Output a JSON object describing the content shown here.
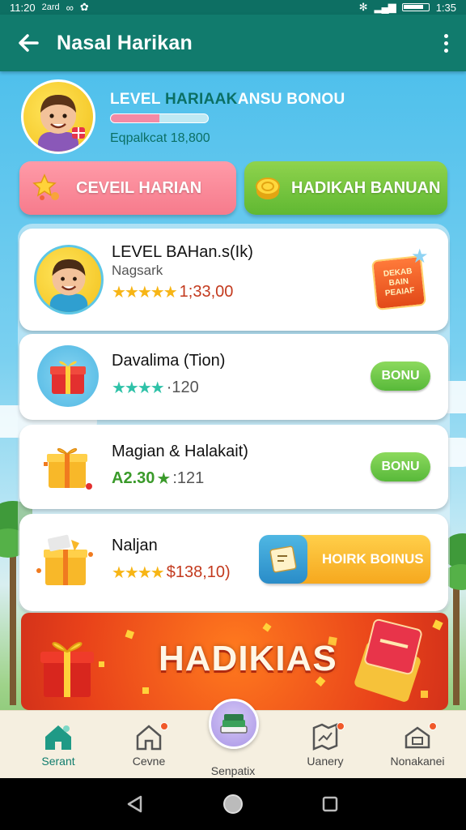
{
  "status_bar": {
    "time": "11:20",
    "carrier": "2ard",
    "clock_right": "1:35"
  },
  "app_bar": {
    "title": "Nasal Harikan"
  },
  "profile": {
    "level_text_a": "LEVEL ",
    "level_text_b": "HARIAAK",
    "level_text_c": "ANSU BONOU",
    "progress_fraction": 0.5,
    "sub_text": "Eqpalkcat 18,800"
  },
  "top_buttons": {
    "level_label": "CEVEIL HARIAN",
    "gift_label": "HADIKAH BANUAN"
  },
  "list": [
    {
      "title": "LEVEL BAHan.s(Ik)",
      "subtitle": "Nagsark",
      "stars": "★★★★★",
      "rating": "1;33,00",
      "badge_lines": [
        "DEKAB",
        "BAIN",
        "PEAIAF"
      ]
    },
    {
      "title": "Davalima (Tion)",
      "stars": "★★★★",
      "rating": "·120",
      "button": "BONU"
    },
    {
      "title": "Magian & Halakait)",
      "rating_prefix": "A2.30",
      "stars": "★",
      "rating": ":121",
      "button": "BONU"
    },
    {
      "title": "Naljan",
      "stars": "★★★★",
      "rating": "$138,10)",
      "button": "HOIRK BOINUS"
    }
  ],
  "banner": {
    "text": "HADIKIAS"
  },
  "bottom_nav": [
    {
      "label": "Serant",
      "icon": "home-icon"
    },
    {
      "label": "Cevne",
      "icon": "house-icon"
    },
    {
      "label": "Senpatix",
      "icon": "books-icon"
    },
    {
      "label": "Uanery",
      "icon": "map-icon"
    },
    {
      "label": "Nonakanei",
      "icon": "store-icon"
    }
  ],
  "colors": {
    "app_bar": "#117b6d",
    "accent_green": "#60b832",
    "accent_pink": "#f67b8c",
    "banner_orange": "#e8411a"
  }
}
